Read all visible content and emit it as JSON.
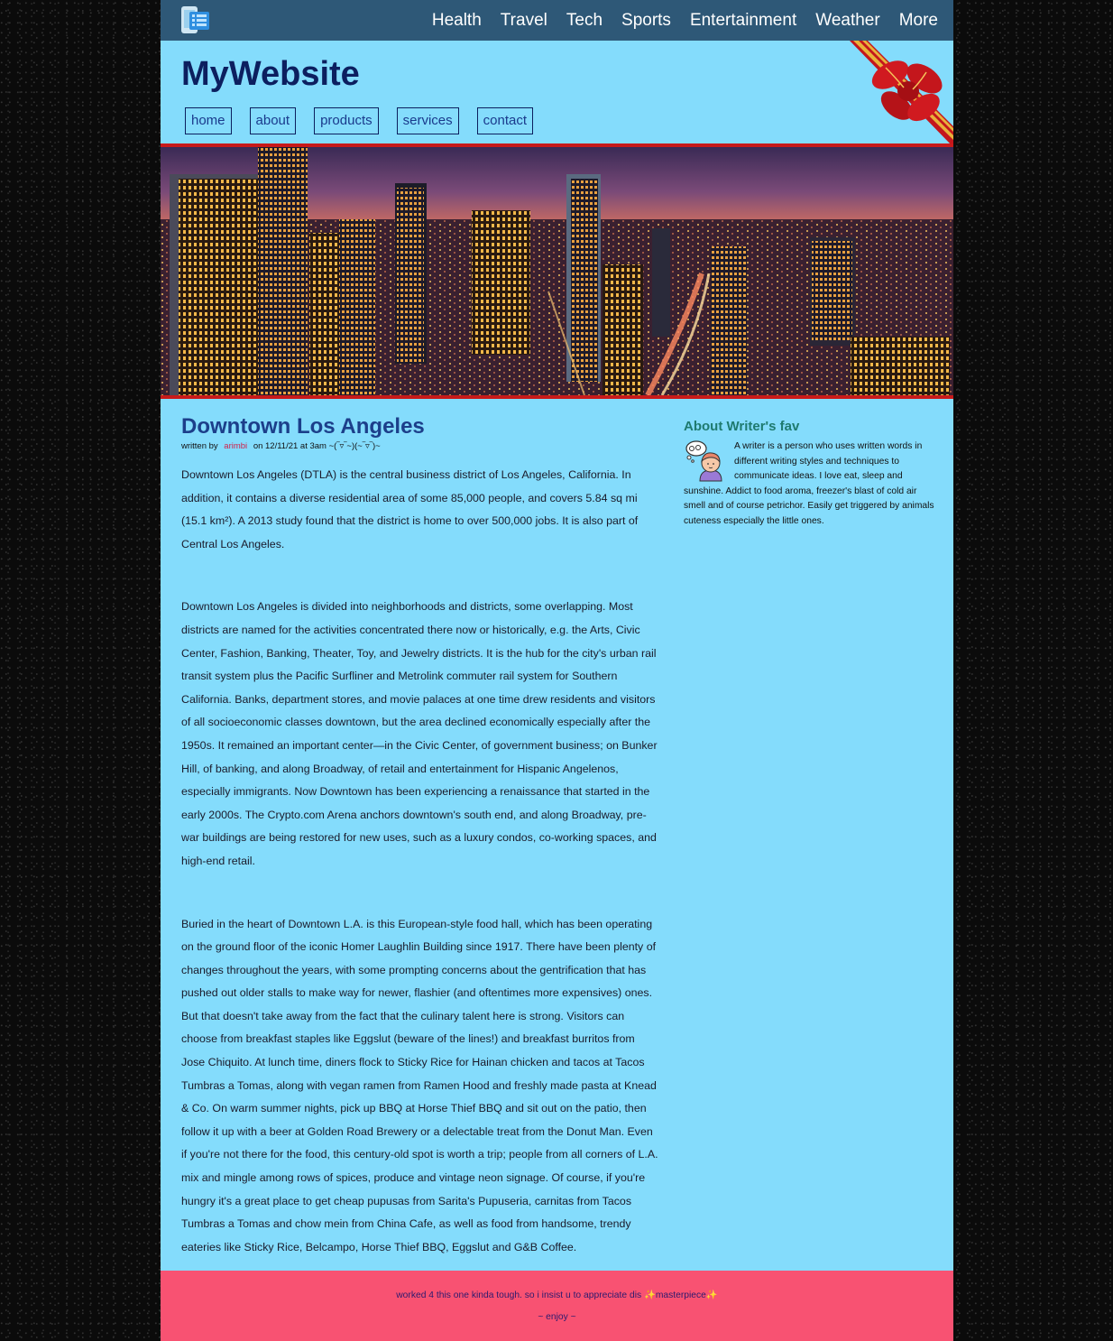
{
  "topnav": {
    "items": [
      {
        "label": "Health"
      },
      {
        "label": "Travel"
      },
      {
        "label": "Tech"
      },
      {
        "label": "Sports"
      },
      {
        "label": "Entertainment"
      },
      {
        "label": "Weather"
      },
      {
        "label": "More"
      }
    ]
  },
  "header": {
    "site_title": "MyWebsite",
    "subnav": [
      {
        "label": "home"
      },
      {
        "label": "about"
      },
      {
        "label": "products"
      },
      {
        "label": "services"
      },
      {
        "label": "contact"
      }
    ]
  },
  "article": {
    "title": "Downtown Los Angeles",
    "byline_prefix": "written by",
    "author": "arimbi",
    "byline_suffix": "on 12/11/21 at 3am ~(‾▿‾~)(~‾▿‾)~",
    "paragraphs": [
      "Downtown Los Angeles (DTLA) is the central business district of Los Angeles, California. In addition, it contains a diverse residential area of some 85,000 people, and covers 5.84 sq mi (15.1 km²). A 2013 study found that the district is home to over 500,000 jobs. It is also part of Central Los Angeles.",
      "Downtown Los Angeles is divided into neighborhoods and districts, some overlapping. Most districts are named for the activities concentrated there now or historically, e.g. the Arts, Civic Center, Fashion, Banking, Theater, Toy, and Jewelry districts. It is the hub for the city's urban rail transit system plus the Pacific Surfliner and Metrolink commuter rail system for Southern California. Banks, department stores, and movie palaces at one time drew residents and visitors of all socioeconomic classes downtown, but the area declined economically especially after the 1950s. It remained an important center—in the Civic Center, of government business; on Bunker Hill, of banking, and along Broadway, of retail and entertainment for Hispanic Angelenos, especially immigrants. Now Downtown has been experiencing a renaissance that started in the early 2000s. The Crypto.com Arena anchors downtown's south end, and along Broadway, pre-war buildings are being restored for new uses, such as a luxury condos, co-working spaces, and high-end retail.",
      "Buried in the heart of Downtown L.A. is this European-style food hall, which has been operating on the ground floor of the iconic Homer Laughlin Building since 1917. There have been plenty of changes throughout the years, with some prompting concerns about the gentrification that has pushed out older stalls to make way for newer, flashier (and oftentimes more expensives) ones. But that doesn't take away from the fact that the culinary talent here is strong. Visitors can choose from breakfast staples like Eggslut (beware of the lines!) and breakfast burritos from Jose Chiquito. At lunch time, diners flock to Sticky Rice for Hainan chicken and tacos at Tacos Tumbras a Tomas, along with vegan ramen from Ramen Hood and freshly made pasta at Knead & Co. On warm summer nights, pick up BBQ at Horse Thief BBQ and sit out on the patio, then follow it up with a beer at Golden Road Brewery or a delectable treat from the Donut Man. Even if you're not there for the food, this century-old spot is worth a trip; people from all corners of L.A. mix and mingle among rows of spices, produce and vintage neon signage. Of course, if you're hungry it's a great place to get cheap pupusas from Sarita's Pupuseria, carnitas from Tacos Tumbras a Tomas and chow mein from China Cafe, as well as food from handsome, trendy eateries like Sticky Rice, Belcampo, Horse Thief BBQ, Eggslut and G&B Coffee."
    ]
  },
  "sidebar": {
    "heading": "About Writer's fav",
    "bio": "A writer is a person who uses written words in different writing styles and techniques to communicate ideas. I love eat, sleep and sunshine. Addict to food aroma, freezer's blast of cold air smell and of course petrichor. Easily get triggered by animals cuteness especially the little ones."
  },
  "footer": {
    "line1": "worked 4 this one kinda tough. so i insist u to appreciate dis ✨masterpiece✨",
    "line2": "~ enjoy ~"
  },
  "colors": {
    "page_bg": "#84dcfc",
    "topbar_bg": "#2e5877",
    "title": "#0c1f5f",
    "article_title": "#1c3f8a",
    "accent_red": "#c81a1a",
    "footer_bg": "#f85272",
    "sidebar_heading": "#1f7a6e",
    "author": "#d0204a"
  },
  "icons": {
    "logo": "phone-list-logo-icon",
    "ribbon": "gift-bow-ribbon-icon",
    "writer": "thinking-girl-icon"
  }
}
